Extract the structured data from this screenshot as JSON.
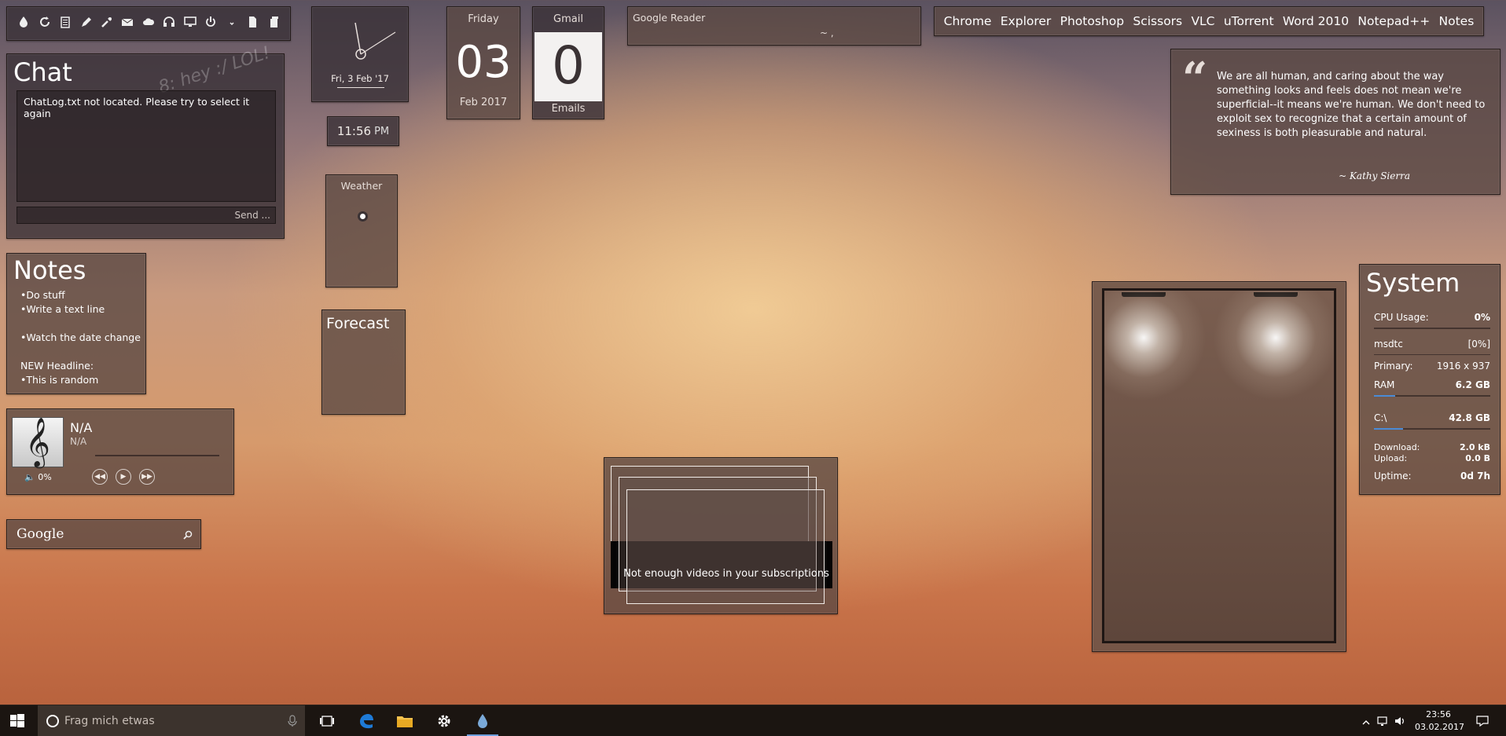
{
  "toolbar": {
    "icons": [
      "drop-icon",
      "refresh-icon",
      "clipboard-icon",
      "pencil-icon",
      "eyedropper-icon",
      "email-icon",
      "cloud-icon",
      "headphones-icon",
      "monitor-icon",
      "power-icon",
      "chevron-down-icon",
      "file-icon",
      "copy-icon"
    ]
  },
  "chat": {
    "title": "Chat",
    "graffiti": "8: hey :/ LOL!",
    "log": "ChatLog.txt not located. Please try to select it again",
    "send_label": "Send ..."
  },
  "notes": {
    "title": "Notes",
    "lines": [
      "•Do stuff",
      "•Write a text line",
      "",
      "•Watch the date change",
      "",
      "NEW Headline:",
      "•This is random"
    ]
  },
  "music": {
    "title": "N/A",
    "artist": "N/A",
    "volume": "0%",
    "progress": 0,
    "controls": [
      "prev",
      "play",
      "next"
    ]
  },
  "google": {
    "label": "Google"
  },
  "clock": {
    "date": "Fri, 3 Feb '17",
    "time": "11:56",
    "ampm": "PM"
  },
  "date": {
    "weekday": "Friday",
    "day": "03",
    "month_year": "Feb 2017"
  },
  "gmail": {
    "label": "Gmail",
    "count": "0",
    "unit": "Emails"
  },
  "weather": {
    "label": "Weather"
  },
  "forecast": {
    "label": "Forecast"
  },
  "reader": {
    "label": "Google Reader",
    "sub": "~ ,"
  },
  "launcher": {
    "items": [
      "Chrome",
      "Explorer",
      "Photoshop",
      "Scissors",
      "VLC",
      "uTorrent",
      "Word 2010",
      "Notepad++",
      "Notes"
    ]
  },
  "quote": {
    "mark": "“",
    "text": "We are all human, and caring about the way something looks and feels does not mean we're superficial--it means we're human. We don't need to exploit sex to recognize that a certain amount of sexiness is both pleasurable and natural.",
    "author": "~ Kathy Sierra"
  },
  "system": {
    "title": "System",
    "cpu_label": "CPU Usage:",
    "cpu_value": "0%",
    "cpu_fraction": 0.0,
    "proc_label": "msdtc",
    "proc_value": "[0%]",
    "primary_label": "Primary:",
    "primary_value": "1916 x 937",
    "ram_label": "RAM",
    "ram_value": "6.2 GB",
    "ram_fraction": 0.18,
    "disk_label": "C:\\",
    "disk_value": "42.8 GB",
    "disk_fraction": 0.25,
    "download_label": "Download:",
    "download_value": "2.0 kB",
    "upload_label": "Upload:",
    "upload_value": "0.0 B",
    "uptime_label": "Uptime:",
    "uptime_value": "0d 7h"
  },
  "videos": {
    "message": "Not enough videos in your subscriptions"
  },
  "taskbar": {
    "search_placeholder": "Frag mich etwas",
    "time": "23:56",
    "date": "03.02.2017",
    "accent": "#6d9fde"
  }
}
